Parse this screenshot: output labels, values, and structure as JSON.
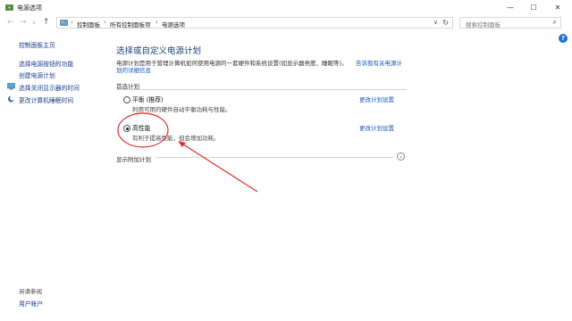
{
  "window": {
    "title": "电源选项"
  },
  "titlebar_buttons": {
    "minimize": "—",
    "maximize": "☐",
    "close": "✕"
  },
  "nav": {
    "back": "←",
    "forward": "→",
    "dropdown": "∨",
    "up": "↑"
  },
  "address": {
    "crumbs": [
      "控制面板",
      "所有控制面板项",
      "电源选项"
    ],
    "separator": "›",
    "dropdown": "∨",
    "refresh": "↻"
  },
  "search": {
    "placeholder": "搜索控制面板",
    "icon": "⌕"
  },
  "sidebar": {
    "items": [
      {
        "label": "控制面板主页"
      },
      {
        "label": "选择电源按钮的功能"
      },
      {
        "label": "创建电源计划"
      },
      {
        "label": "选择关闭显示器的时间"
      },
      {
        "label": "更改计算机睡眠时间"
      }
    ],
    "see_also": "另请参阅",
    "user_accounts": "用户帐户"
  },
  "help": "?",
  "main": {
    "title": "选择或自定义电源计划",
    "description": "电源计划是用于管理计算机如何使用电源的一套硬件和系统设置(如显示器亮度、睡眠等)。",
    "desc_link_part1": "告诉我有关电源计",
    "desc_link_part2": "划的详细信息",
    "section_label": "首选计划",
    "plans": [
      {
        "name": "平衡 (推荐)",
        "desc": "利用可用的硬件自动平衡功耗与性能。",
        "change": "更改计划设置",
        "selected": false
      },
      {
        "name": "高性能",
        "desc": "有利于提高性能，但会增加功耗。",
        "change": "更改计划设置",
        "selected": true
      }
    ],
    "more_plans": "显示附加计划",
    "expand_icon": "⌄"
  },
  "colors": {
    "link": "#1a55c0",
    "title": "#1e3d7a",
    "annotation": "#e03030"
  }
}
